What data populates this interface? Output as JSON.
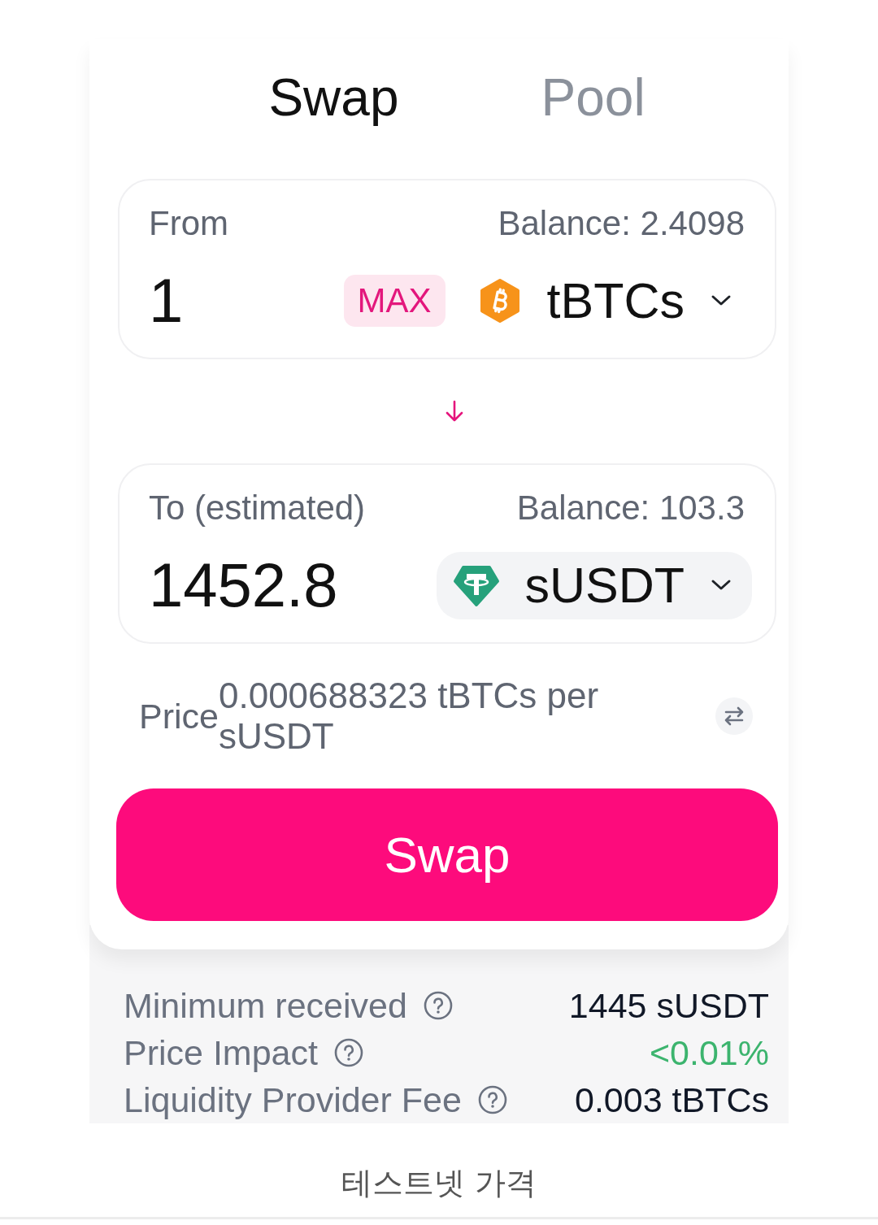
{
  "tabs": [
    {
      "label": "Swap",
      "selected": true
    },
    {
      "label": "Pool",
      "selected": false
    }
  ],
  "from": {
    "label": "From",
    "balance": "Balance: 2.4098",
    "amount": "1",
    "max": "MAX",
    "token": "tBTCs",
    "highlighted": false
  },
  "to": {
    "label": "To (estimated)",
    "balance": "Balance: 103.3",
    "amount": "1452.8",
    "token": "sUSDT",
    "highlighted": true
  },
  "price": {
    "label": "Price",
    "value": "0.000688323 tBTCs per sUSDT"
  },
  "swap_button": "Swap",
  "details": [
    {
      "label": "Minimum received",
      "value": "1445 sUSDT",
      "color": "#111827"
    },
    {
      "label": "Price Impact",
      "value": "<0.01%",
      "color": "#3cb46e"
    },
    {
      "label": "Liquidity Provider Fee",
      "value": "0.003 tBTCs",
      "color": "#111827"
    }
  ],
  "caption": "테스트넷 가격"
}
